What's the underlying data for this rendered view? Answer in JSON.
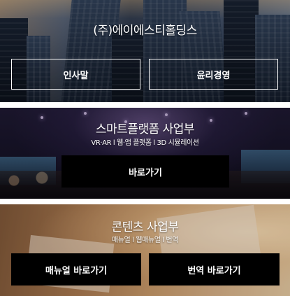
{
  "hero": {
    "title": "(주)에이에스티홀딩스",
    "buttons": [
      "인사말",
      "윤리경영"
    ]
  },
  "smart_platform": {
    "title": "스마트플랫폼 사업부",
    "subtitle": "VR·AR l 웹·앱 플랫폼 l 3D 시뮬레이션",
    "button_label": "바로가기"
  },
  "contents": {
    "title": "콘텐츠 사업부",
    "subtitle": "매뉴얼 l 웹매뉴얼 l 번역",
    "buttons": [
      "매뉴얼 바로가기",
      "번역 바로가기"
    ]
  },
  "colors": {
    "button_bg": "#000000",
    "text": "#ffffff",
    "divider": "#ffffff"
  }
}
